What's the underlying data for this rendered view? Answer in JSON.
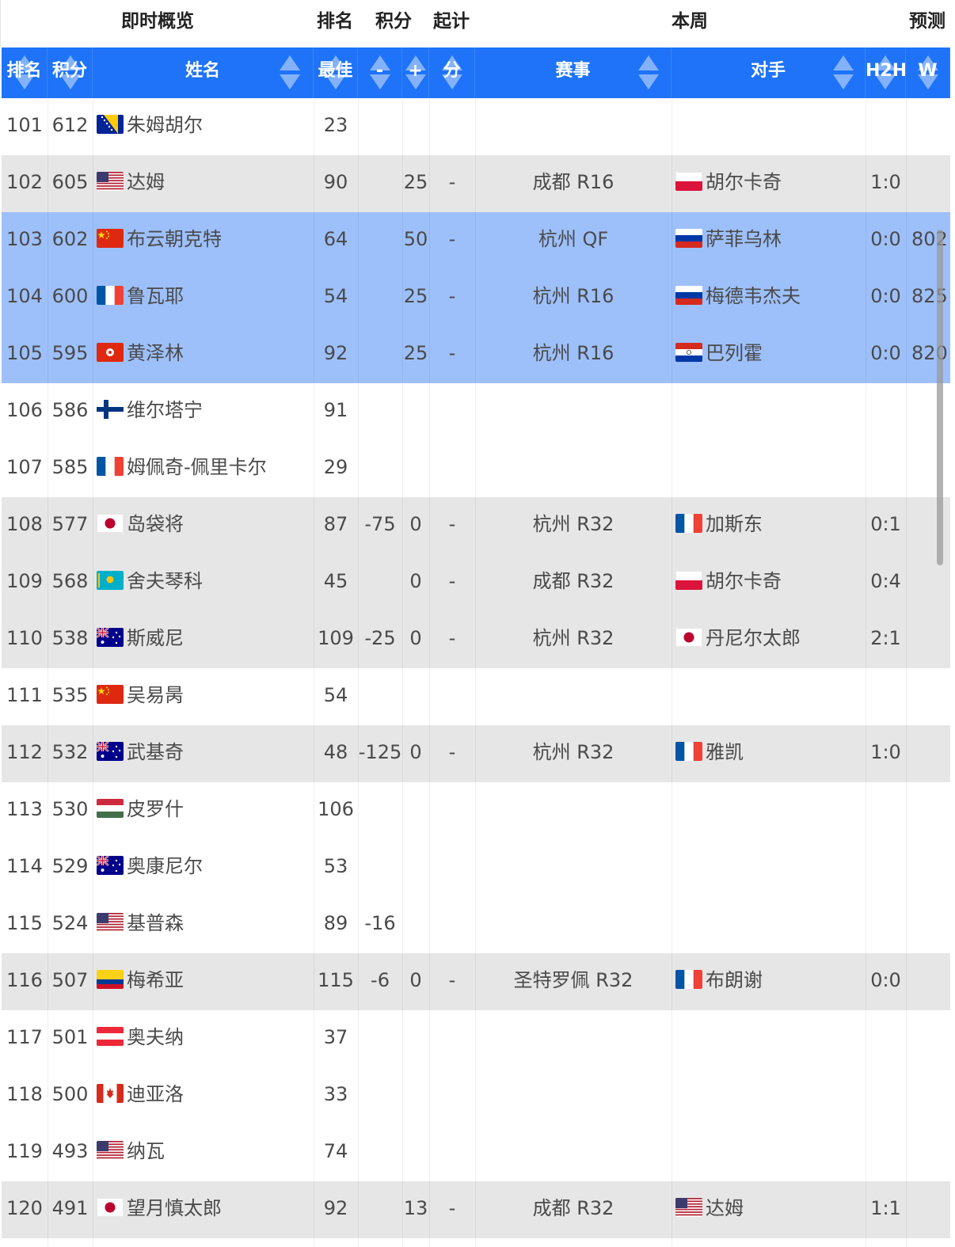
{
  "group_headers": {
    "live_overview": "即时概览",
    "rank": "排名",
    "points": "积分",
    "start": "起计",
    "this_week": "本周",
    "prediction": "预测"
  },
  "column_headers": {
    "rank": "排名",
    "points": "积分",
    "name": "姓名",
    "best": "最佳",
    "rank_change": "-",
    "points_change": "+",
    "start_points": "分",
    "event": "赛事",
    "opponent": "对手",
    "h2h": "H2H",
    "win": "W"
  },
  "rows": [
    {
      "rank": "101",
      "points": "612",
      "flag": "bosnia-flag-icon",
      "name": "朱姆胡尔",
      "best": "23",
      "chg": "",
      "plus": "",
      "start": "",
      "event": "",
      "opp_flag": "",
      "opponent": "",
      "h2h": "",
      "w": "",
      "bg": "white"
    },
    {
      "rank": "102",
      "points": "605",
      "flag": "usa-flag-icon",
      "name": "达姆",
      "best": "90",
      "chg": "",
      "plus": "25",
      "start": "-",
      "event": "成都 R16",
      "opp_flag": "poland-flag-icon",
      "opponent": "胡尔卡奇",
      "h2h": "1:0",
      "w": "",
      "bg": "gray"
    },
    {
      "rank": "103",
      "points": "602",
      "flag": "china-flag-icon",
      "name": "布云朝克特",
      "best": "64",
      "chg": "",
      "plus": "50",
      "start": "-",
      "event": "杭州 QF",
      "opp_flag": "russia-flag-icon",
      "opponent": "萨菲乌林",
      "h2h": "0:0",
      "w": "802",
      "bg": "blue"
    },
    {
      "rank": "104",
      "points": "600",
      "flag": "france-flag-icon",
      "name": "鲁瓦耶",
      "best": "54",
      "chg": "",
      "plus": "25",
      "start": "-",
      "event": "杭州 R16",
      "opp_flag": "russia-flag-icon",
      "opponent": "梅德韦杰夫",
      "h2h": "0:0",
      "w": "825",
      "bg": "blue"
    },
    {
      "rank": "105",
      "points": "595",
      "flag": "hongkong-flag-icon",
      "name": "黄泽林",
      "best": "92",
      "chg": "",
      "plus": "25",
      "start": "-",
      "event": "杭州 R16",
      "opp_flag": "paraguay-flag-icon",
      "opponent": "巴列霍",
      "h2h": "0:0",
      "w": "820",
      "bg": "blue"
    },
    {
      "rank": "106",
      "points": "586",
      "flag": "finland-flag-icon",
      "name": "维尔塔宁",
      "best": "91",
      "chg": "",
      "plus": "",
      "start": "",
      "event": "",
      "opp_flag": "",
      "opponent": "",
      "h2h": "",
      "w": "",
      "bg": "white"
    },
    {
      "rank": "107",
      "points": "585",
      "flag": "france-flag-icon",
      "name": "姆佩奇-佩里卡尔",
      "best": "29",
      "chg": "",
      "plus": "",
      "start": "",
      "event": "",
      "opp_flag": "",
      "opponent": "",
      "h2h": "",
      "w": "",
      "bg": "white"
    },
    {
      "rank": "108",
      "points": "577",
      "flag": "japan-flag-icon",
      "name": "岛袋将",
      "best": "87",
      "chg": "-75",
      "plus": "0",
      "start": "-",
      "event": "杭州 R32",
      "opp_flag": "france-flag-icon",
      "opponent": "加斯东",
      "h2h": "0:1",
      "w": "",
      "bg": "gray"
    },
    {
      "rank": "109",
      "points": "568",
      "flag": "kazakhstan-flag-icon",
      "name": "舍夫琴科",
      "best": "45",
      "chg": "",
      "plus": "0",
      "start": "-",
      "event": "成都 R32",
      "opp_flag": "poland-flag-icon",
      "opponent": "胡尔卡奇",
      "h2h": "0:4",
      "w": "",
      "bg": "gray"
    },
    {
      "rank": "110",
      "points": "538",
      "flag": "australia-flag-icon",
      "name": "斯威尼",
      "best": "109",
      "chg": "-25",
      "plus": "0",
      "start": "-",
      "event": "杭州 R32",
      "opp_flag": "japan-flag-icon",
      "opponent": "丹尼尔太郎",
      "h2h": "2:1",
      "w": "",
      "bg": "gray"
    },
    {
      "rank": "111",
      "points": "535",
      "flag": "china-flag-icon",
      "name": "吴易昺",
      "best": "54",
      "chg": "",
      "plus": "",
      "start": "",
      "event": "",
      "opp_flag": "",
      "opponent": "",
      "h2h": "",
      "w": "",
      "bg": "white"
    },
    {
      "rank": "112",
      "points": "532",
      "flag": "australia-flag-icon",
      "name": "武基奇",
      "best": "48",
      "chg": "-125",
      "plus": "0",
      "start": "-",
      "event": "杭州 R32",
      "opp_flag": "france-flag-icon",
      "opponent": "雅凯",
      "h2h": "1:0",
      "w": "",
      "bg": "gray"
    },
    {
      "rank": "113",
      "points": "530",
      "flag": "hungary-flag-icon",
      "name": "皮罗什",
      "best": "106",
      "chg": "",
      "plus": "",
      "start": "",
      "event": "",
      "opp_flag": "",
      "opponent": "",
      "h2h": "",
      "w": "",
      "bg": "white"
    },
    {
      "rank": "114",
      "points": "529",
      "flag": "australia-flag-icon",
      "name": "奥康尼尔",
      "best": "53",
      "chg": "",
      "plus": "",
      "start": "",
      "event": "",
      "opp_flag": "",
      "opponent": "",
      "h2h": "",
      "w": "",
      "bg": "white"
    },
    {
      "rank": "115",
      "points": "524",
      "flag": "usa-flag-icon",
      "name": "基普森",
      "best": "89",
      "chg": "-16",
      "plus": "",
      "start": "",
      "event": "",
      "opp_flag": "",
      "opponent": "",
      "h2h": "",
      "w": "",
      "bg": "white"
    },
    {
      "rank": "116",
      "points": "507",
      "flag": "colombia-flag-icon",
      "name": "梅希亚",
      "best": "115",
      "chg": "-6",
      "plus": "0",
      "start": "-",
      "event": "圣特罗佩 R32",
      "opp_flag": "france-flag-icon",
      "opponent": "布朗谢",
      "h2h": "0:0",
      "w": "",
      "bg": "gray"
    },
    {
      "rank": "117",
      "points": "501",
      "flag": "austria-flag-icon",
      "name": "奥夫纳",
      "best": "37",
      "chg": "",
      "plus": "",
      "start": "",
      "event": "",
      "opp_flag": "",
      "opponent": "",
      "h2h": "",
      "w": "",
      "bg": "white"
    },
    {
      "rank": "118",
      "points": "500",
      "flag": "canada-flag-icon",
      "name": "迪亚洛",
      "best": "33",
      "chg": "",
      "plus": "",
      "start": "",
      "event": "",
      "opp_flag": "",
      "opponent": "",
      "h2h": "",
      "w": "",
      "bg": "white"
    },
    {
      "rank": "119",
      "points": "493",
      "flag": "usa-flag-icon",
      "name": "纳瓦",
      "best": "74",
      "chg": "",
      "plus": "",
      "start": "",
      "event": "",
      "opp_flag": "",
      "opponent": "",
      "h2h": "",
      "w": "",
      "bg": "white"
    },
    {
      "rank": "120",
      "points": "491",
      "flag": "japan-flag-icon",
      "name": "望月慎太郎",
      "best": "92",
      "chg": "",
      "plus": "13",
      "start": "-",
      "event": "成都 R32",
      "opp_flag": "usa-flag-icon",
      "opponent": "达姆",
      "h2h": "1:1",
      "w": "",
      "bg": "gray"
    }
  ],
  "colors": {
    "header_blue": "#1e73f8",
    "highlight_blue": "#9dc0fb",
    "stripe_gray": "#e6e6e6",
    "text": "#4a4a4a"
  }
}
